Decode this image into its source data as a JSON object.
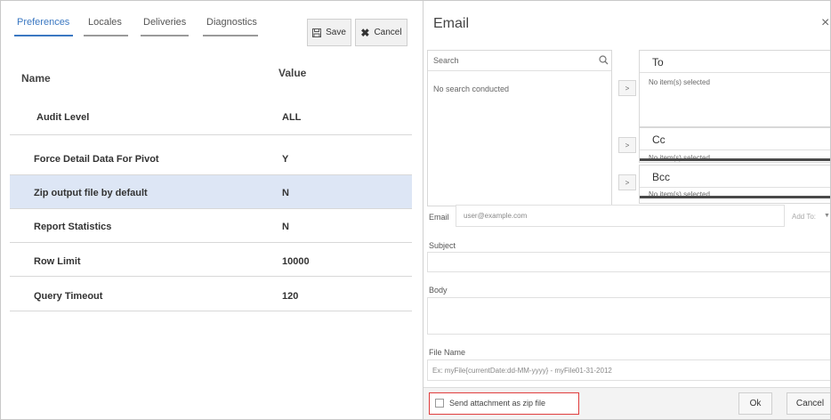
{
  "tabs": [
    {
      "label": "Preferences"
    },
    {
      "label": "Locales"
    },
    {
      "label": "Deliveries"
    },
    {
      "label": "Diagnostics"
    }
  ],
  "toolbar": {
    "save_label": "Save",
    "cancel_label": "Cancel"
  },
  "table": {
    "columns": [
      "Name",
      "Value"
    ],
    "rows": [
      {
        "name": "Audit Level",
        "value": "ALL"
      },
      {
        "name": "Force Detail Data For Pivot",
        "value": "Y"
      },
      {
        "name": "Zip output file by default",
        "value": "N"
      },
      {
        "name": "Report Statistics",
        "value": "N"
      },
      {
        "name": "Row Limit",
        "value": "10000"
      },
      {
        "name": "Query Timeout",
        "value": "120"
      }
    ]
  },
  "dialog": {
    "title": "Email",
    "close_glyph": "×",
    "search": {
      "placeholder": "Search",
      "status": "No search conducted"
    },
    "move_glyph": ">",
    "recipients": {
      "to": {
        "label": "To",
        "status": "No item(s) selected"
      },
      "cc": {
        "label": "Cc",
        "status": "No item(s) selected"
      },
      "bcc": {
        "label": "Bcc",
        "status": "No item(s) selected"
      }
    },
    "email": {
      "label": "Email",
      "placeholder": "user@example.com",
      "add_to": "Add To:"
    },
    "subject": {
      "label": "Subject"
    },
    "body": {
      "label": "Body"
    },
    "file_name": {
      "label": "File Name",
      "placeholder": "Ex: myFile{currentDate:dd-MM-yyyy} - myFile01-31-2012"
    },
    "zip_checkbox": {
      "label": "Send attachment as zip file",
      "checked": false
    },
    "ok_label": "Ok",
    "cancel_label": "Cancel"
  },
  "colors": {
    "accent": "#3b78c2",
    "selected_row": "#dde6f5",
    "highlight_border": "#e03c3c"
  }
}
